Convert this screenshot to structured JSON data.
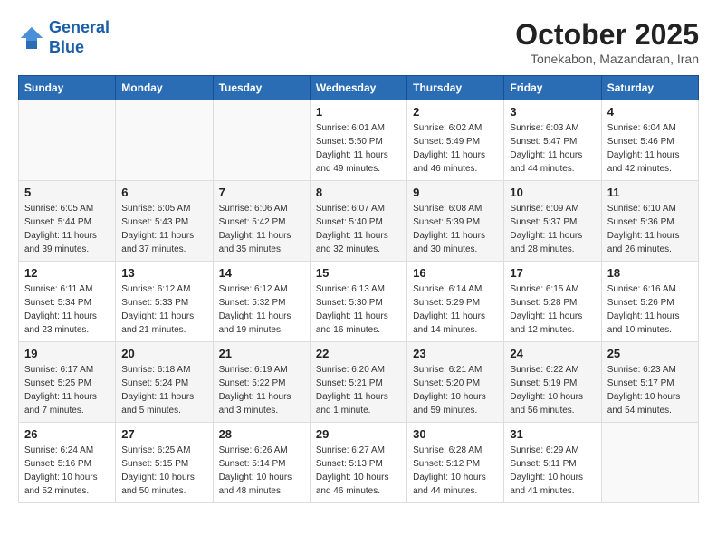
{
  "header": {
    "logo_line1": "General",
    "logo_line2": "Blue",
    "month": "October 2025",
    "location": "Tonekabon, Mazandaran, Iran"
  },
  "weekdays": [
    "Sunday",
    "Monday",
    "Tuesday",
    "Wednesday",
    "Thursday",
    "Friday",
    "Saturday"
  ],
  "weeks": [
    [
      {
        "day": "",
        "sunrise": "",
        "sunset": "",
        "daylight": ""
      },
      {
        "day": "",
        "sunrise": "",
        "sunset": "",
        "daylight": ""
      },
      {
        "day": "",
        "sunrise": "",
        "sunset": "",
        "daylight": ""
      },
      {
        "day": "1",
        "sunrise": "Sunrise: 6:01 AM",
        "sunset": "Sunset: 5:50 PM",
        "daylight": "Daylight: 11 hours and 49 minutes."
      },
      {
        "day": "2",
        "sunrise": "Sunrise: 6:02 AM",
        "sunset": "Sunset: 5:49 PM",
        "daylight": "Daylight: 11 hours and 46 minutes."
      },
      {
        "day": "3",
        "sunrise": "Sunrise: 6:03 AM",
        "sunset": "Sunset: 5:47 PM",
        "daylight": "Daylight: 11 hours and 44 minutes."
      },
      {
        "day": "4",
        "sunrise": "Sunrise: 6:04 AM",
        "sunset": "Sunset: 5:46 PM",
        "daylight": "Daylight: 11 hours and 42 minutes."
      }
    ],
    [
      {
        "day": "5",
        "sunrise": "Sunrise: 6:05 AM",
        "sunset": "Sunset: 5:44 PM",
        "daylight": "Daylight: 11 hours and 39 minutes."
      },
      {
        "day": "6",
        "sunrise": "Sunrise: 6:05 AM",
        "sunset": "Sunset: 5:43 PM",
        "daylight": "Daylight: 11 hours and 37 minutes."
      },
      {
        "day": "7",
        "sunrise": "Sunrise: 6:06 AM",
        "sunset": "Sunset: 5:42 PM",
        "daylight": "Daylight: 11 hours and 35 minutes."
      },
      {
        "day": "8",
        "sunrise": "Sunrise: 6:07 AM",
        "sunset": "Sunset: 5:40 PM",
        "daylight": "Daylight: 11 hours and 32 minutes."
      },
      {
        "day": "9",
        "sunrise": "Sunrise: 6:08 AM",
        "sunset": "Sunset: 5:39 PM",
        "daylight": "Daylight: 11 hours and 30 minutes."
      },
      {
        "day": "10",
        "sunrise": "Sunrise: 6:09 AM",
        "sunset": "Sunset: 5:37 PM",
        "daylight": "Daylight: 11 hours and 28 minutes."
      },
      {
        "day": "11",
        "sunrise": "Sunrise: 6:10 AM",
        "sunset": "Sunset: 5:36 PM",
        "daylight": "Daylight: 11 hours and 26 minutes."
      }
    ],
    [
      {
        "day": "12",
        "sunrise": "Sunrise: 6:11 AM",
        "sunset": "Sunset: 5:34 PM",
        "daylight": "Daylight: 11 hours and 23 minutes."
      },
      {
        "day": "13",
        "sunrise": "Sunrise: 6:12 AM",
        "sunset": "Sunset: 5:33 PM",
        "daylight": "Daylight: 11 hours and 21 minutes."
      },
      {
        "day": "14",
        "sunrise": "Sunrise: 6:12 AM",
        "sunset": "Sunset: 5:32 PM",
        "daylight": "Daylight: 11 hours and 19 minutes."
      },
      {
        "day": "15",
        "sunrise": "Sunrise: 6:13 AM",
        "sunset": "Sunset: 5:30 PM",
        "daylight": "Daylight: 11 hours and 16 minutes."
      },
      {
        "day": "16",
        "sunrise": "Sunrise: 6:14 AM",
        "sunset": "Sunset: 5:29 PM",
        "daylight": "Daylight: 11 hours and 14 minutes."
      },
      {
        "day": "17",
        "sunrise": "Sunrise: 6:15 AM",
        "sunset": "Sunset: 5:28 PM",
        "daylight": "Daylight: 11 hours and 12 minutes."
      },
      {
        "day": "18",
        "sunrise": "Sunrise: 6:16 AM",
        "sunset": "Sunset: 5:26 PM",
        "daylight": "Daylight: 11 hours and 10 minutes."
      }
    ],
    [
      {
        "day": "19",
        "sunrise": "Sunrise: 6:17 AM",
        "sunset": "Sunset: 5:25 PM",
        "daylight": "Daylight: 11 hours and 7 minutes."
      },
      {
        "day": "20",
        "sunrise": "Sunrise: 6:18 AM",
        "sunset": "Sunset: 5:24 PM",
        "daylight": "Daylight: 11 hours and 5 minutes."
      },
      {
        "day": "21",
        "sunrise": "Sunrise: 6:19 AM",
        "sunset": "Sunset: 5:22 PM",
        "daylight": "Daylight: 11 hours and 3 minutes."
      },
      {
        "day": "22",
        "sunrise": "Sunrise: 6:20 AM",
        "sunset": "Sunset: 5:21 PM",
        "daylight": "Daylight: 11 hours and 1 minute."
      },
      {
        "day": "23",
        "sunrise": "Sunrise: 6:21 AM",
        "sunset": "Sunset: 5:20 PM",
        "daylight": "Daylight: 10 hours and 59 minutes."
      },
      {
        "day": "24",
        "sunrise": "Sunrise: 6:22 AM",
        "sunset": "Sunset: 5:19 PM",
        "daylight": "Daylight: 10 hours and 56 minutes."
      },
      {
        "day": "25",
        "sunrise": "Sunrise: 6:23 AM",
        "sunset": "Sunset: 5:17 PM",
        "daylight": "Daylight: 10 hours and 54 minutes."
      }
    ],
    [
      {
        "day": "26",
        "sunrise": "Sunrise: 6:24 AM",
        "sunset": "Sunset: 5:16 PM",
        "daylight": "Daylight: 10 hours and 52 minutes."
      },
      {
        "day": "27",
        "sunrise": "Sunrise: 6:25 AM",
        "sunset": "Sunset: 5:15 PM",
        "daylight": "Daylight: 10 hours and 50 minutes."
      },
      {
        "day": "28",
        "sunrise": "Sunrise: 6:26 AM",
        "sunset": "Sunset: 5:14 PM",
        "daylight": "Daylight: 10 hours and 48 minutes."
      },
      {
        "day": "29",
        "sunrise": "Sunrise: 6:27 AM",
        "sunset": "Sunset: 5:13 PM",
        "daylight": "Daylight: 10 hours and 46 minutes."
      },
      {
        "day": "30",
        "sunrise": "Sunrise: 6:28 AM",
        "sunset": "Sunset: 5:12 PM",
        "daylight": "Daylight: 10 hours and 44 minutes."
      },
      {
        "day": "31",
        "sunrise": "Sunrise: 6:29 AM",
        "sunset": "Sunset: 5:11 PM",
        "daylight": "Daylight: 10 hours and 41 minutes."
      },
      {
        "day": "",
        "sunrise": "",
        "sunset": "",
        "daylight": ""
      }
    ]
  ]
}
